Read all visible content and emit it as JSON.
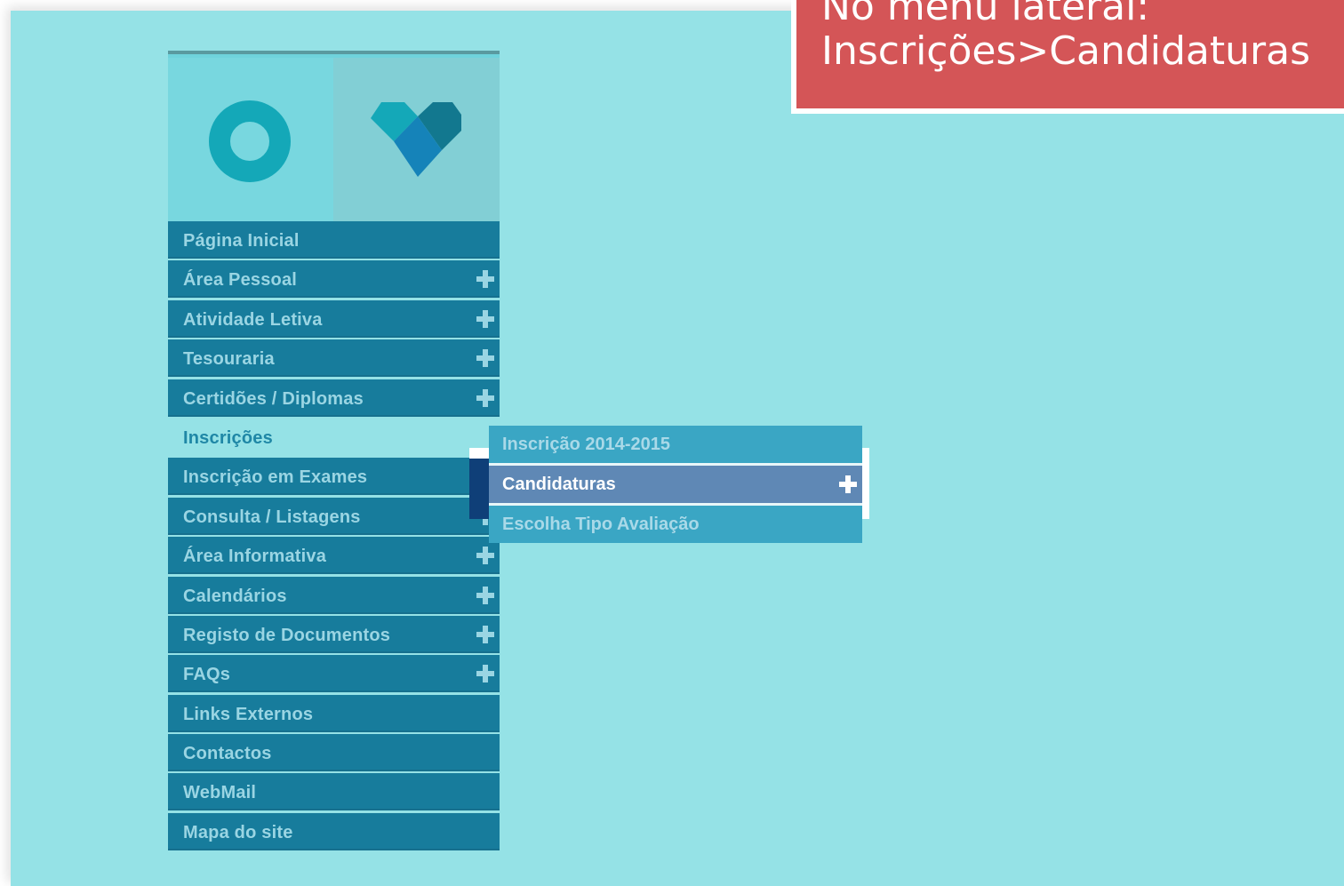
{
  "callout": {
    "line1": "No menu lateral:",
    "line2": "Inscrições>Candidaturas"
  },
  "logo": {
    "left_icon": "ring-icon",
    "right_icon": "heart-icon"
  },
  "menu": {
    "items": [
      {
        "label": "Página Inicial",
        "expandable": false
      },
      {
        "label": "Área Pessoal",
        "expandable": true
      },
      {
        "label": "Atividade Letiva",
        "expandable": true
      },
      {
        "label": "Tesouraria",
        "expandable": true
      },
      {
        "label": "Certidões / Diplomas",
        "expandable": true
      },
      {
        "label": "Inscrições",
        "expandable": true,
        "active": true
      },
      {
        "label": "Inscrição em Exames",
        "expandable": true
      },
      {
        "label": "Consulta / Listagens",
        "expandable": true
      },
      {
        "label": "Área Informativa",
        "expandable": true
      },
      {
        "label": "Calendários",
        "expandable": true
      },
      {
        "label": "Registo de Documentos",
        "expandable": true
      },
      {
        "label": "FAQs",
        "expandable": true
      },
      {
        "label": "Links Externos",
        "expandable": false
      },
      {
        "label": "Contactos",
        "expandable": false
      },
      {
        "label": "WebMail",
        "expandable": false
      },
      {
        "label": "Mapa do site",
        "expandable": false
      }
    ]
  },
  "submenu": {
    "items": [
      {
        "label": "Inscrição 2014-2015",
        "expandable": false
      },
      {
        "label": "Candidaturas",
        "expandable": true,
        "highlighted": true
      },
      {
        "label": "Escolha Tipo Avaliação",
        "expandable": false
      }
    ]
  },
  "colors": {
    "background": "#95e2e6",
    "menu_bg": "#177c9c",
    "callout_bg": "#d45557",
    "submenu_bg": "#3aa6c4",
    "submenu_highlight": "#5f88b5"
  }
}
